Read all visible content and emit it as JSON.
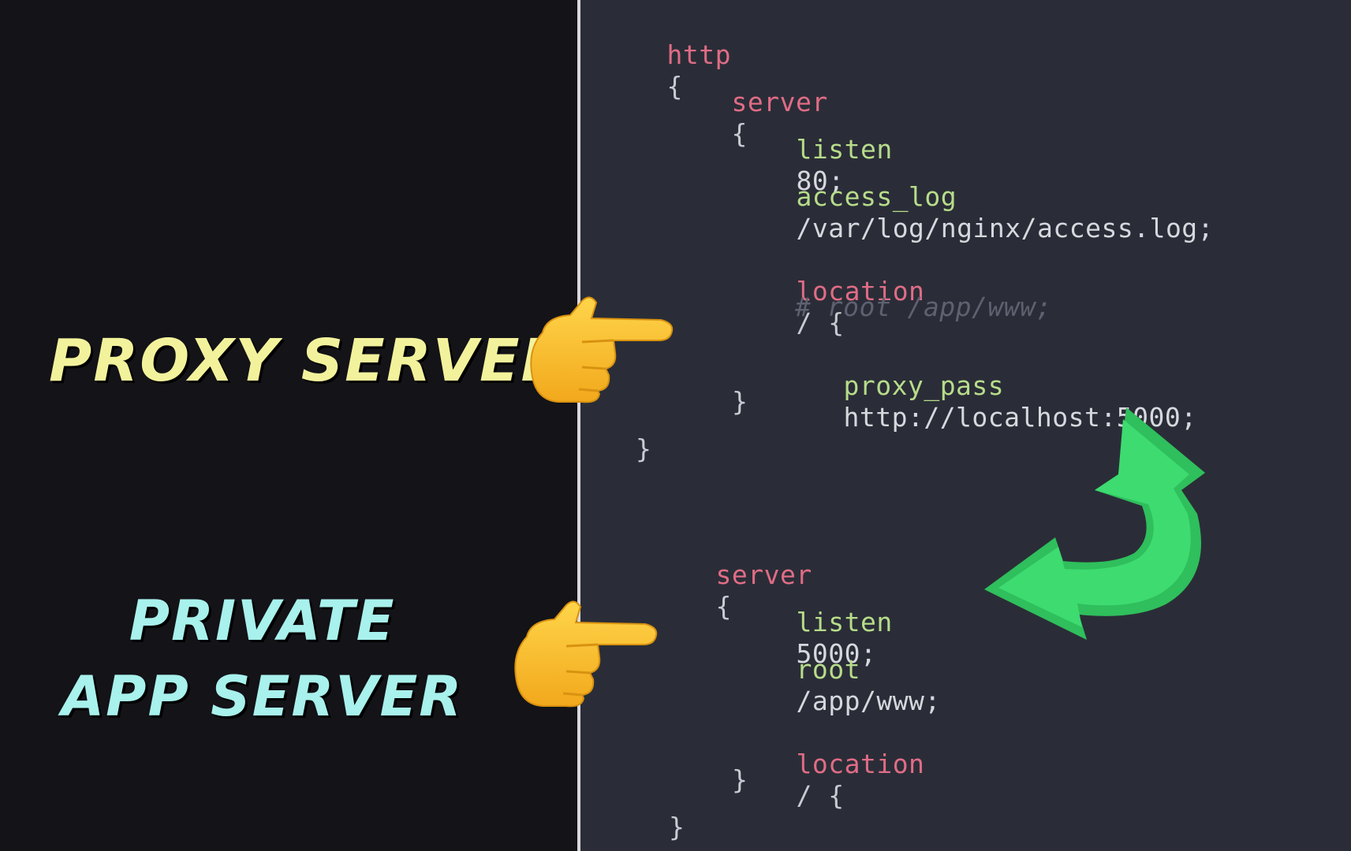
{
  "labels": {
    "proxy": "PROXY SERVER",
    "private_line1": "PRIVATE",
    "private_line2": "APP SERVER"
  },
  "code": {
    "http": "http",
    "server": "server",
    "listen": "listen",
    "port80": "80;",
    "access_log": "access_log",
    "access_log_path": "/var/log/nginx/access.log;",
    "location": "location",
    "slash_brace": "/ {",
    "comment": "# root /app/www;",
    "proxy_pass": "proxy_pass",
    "proxy_url": "http://localhost:5000;",
    "port5000": "5000;",
    "root": "root",
    "root_path": "/app/www;",
    "open_brace": "{",
    "close_brace": "}"
  },
  "icons": {
    "hand": "pointing-right-hand-icon",
    "arrow": "curved-return-arrow-icon"
  },
  "colors": {
    "proxy_label": "#f3f29c",
    "private_label": "#a8f1ec",
    "arrow": "#35d36a",
    "hand": "#f6bf26"
  }
}
